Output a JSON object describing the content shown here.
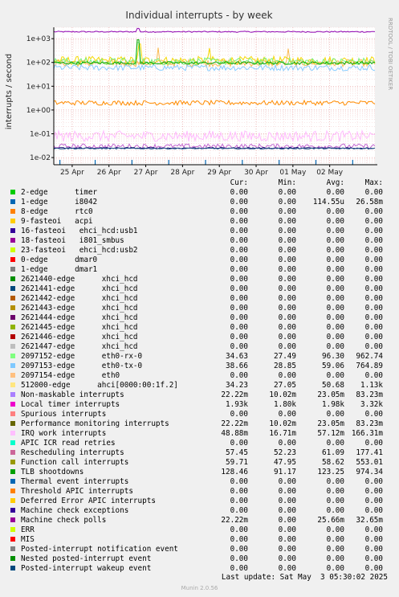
{
  "chart_data": {
    "type": "line",
    "title": "Individual interrupts - by week",
    "ylabel": "interrupts / second",
    "yscale": "log",
    "ylim": [
      0.005,
      3000
    ],
    "yticks": [
      {
        "v": 0.01,
        "label": "1e-02"
      },
      {
        "v": 0.1,
        "label": "1e-01"
      },
      {
        "v": 1,
        "label": "1e+00"
      },
      {
        "v": 10,
        "label": "1e+01"
      },
      {
        "v": 100,
        "label": "1e+02"
      },
      {
        "v": 1000,
        "label": "1e+03"
      }
    ],
    "xlim": [
      "2025-04-24T12:00",
      "2025-05-03T05:30"
    ],
    "xticks": [
      {
        "v": "2025-04-25T00:00",
        "label": "25 Apr"
      },
      {
        "v": "2025-04-26T00:00",
        "label": "26 Apr"
      },
      {
        "v": "2025-04-27T00:00",
        "label": "27 Apr"
      },
      {
        "v": "2025-04-28T00:00",
        "label": "28 Apr"
      },
      {
        "v": "2025-04-29T00:00",
        "label": "29 Apr"
      },
      {
        "v": "2025-04-30T00:00",
        "label": "30 Apr"
      },
      {
        "v": "2025-05-01T00:00",
        "label": "01 May"
      },
      {
        "v": "2025-05-02T00:00",
        "label": "02 May"
      }
    ],
    "grid": true,
    "series_plot": [
      {
        "color": "#8d02b0",
        "base": 1950,
        "noise": 0.05,
        "spikes": [
          [
            "2025-04-26T19:00",
            2700
          ]
        ]
      },
      {
        "color": "#f5d700",
        "base": 120,
        "noise": 0.35,
        "spikes": [
          [
            "2025-04-26T20:00",
            600
          ],
          [
            "2025-04-28T18:00",
            400
          ]
        ]
      },
      {
        "color": "#fab950",
        "base": 95,
        "noise": 0.3,
        "spikes": [
          [
            "2025-04-27T08:00",
            420
          ],
          [
            "2025-04-30T21:00",
            380
          ]
        ]
      },
      {
        "color": "#88ccff",
        "base": 60,
        "noise": 0.25,
        "spikes": []
      },
      {
        "color": "#7bf07b",
        "base": 110,
        "noise": 0.3,
        "spikes": [
          [
            "2025-04-26T19:00",
            700
          ]
        ]
      },
      {
        "color": "#00aa00",
        "base": 95,
        "noise": 0.12,
        "spikes": [
          [
            "2025-04-26T19:00",
            900
          ]
        ]
      },
      {
        "color": "#ff8c00",
        "base": 2,
        "noise": 0.2,
        "spikes": []
      },
      {
        "color": "#ffbbff",
        "base": 0.08,
        "noise": 0.45,
        "spikes": []
      },
      {
        "color": "#c266d1",
        "base": 0.03,
        "noise": 0.2,
        "spikes": []
      },
      {
        "color": "#000066",
        "base": 0.025,
        "noise": 0.05,
        "spikes": []
      },
      {
        "color": "#2a5c8a",
        "base": 0.024,
        "noise": 0.05,
        "spikes": []
      }
    ],
    "pulses": [
      "2025-04-24T16:00",
      "2025-04-25T15:00",
      "2025-04-26T15:00",
      "2025-04-27T15:00",
      "2025-04-28T15:00",
      "2025-04-29T15:00",
      "2025-04-30T15:00",
      "2025-05-01T15:00",
      "2025-05-02T15:00"
    ],
    "pulse_color": "#0066b3"
  },
  "side_label": "RRDTOOL / TOBI OETIKER",
  "legend": {
    "headers": {
      "cur": "Cur:",
      "min": "Min:",
      "avg": "Avg:",
      "max": "Max:"
    },
    "rows": [
      {
        "color": "#00cc00",
        "label": "2-edge      timer",
        "cur": "0.00",
        "min": "0.00",
        "avg": "0.00",
        "max": "0.00"
      },
      {
        "color": "#0066b3",
        "label": "1-edge      i8042",
        "cur": "0.00",
        "min": "0.00",
        "avg": "114.55u",
        "max": "26.58m"
      },
      {
        "color": "#ff8000",
        "label": "8-edge      rtc0",
        "cur": "0.00",
        "min": "0.00",
        "avg": "0.00",
        "max": "0.00"
      },
      {
        "color": "#ffcc00",
        "label": "9-fasteoi   acpi",
        "cur": "0.00",
        "min": "0.00",
        "avg": "0.00",
        "max": "0.00"
      },
      {
        "color": "#330099",
        "label": "16-fasteoi   ehci_hcd:usb1",
        "cur": "0.00",
        "min": "0.00",
        "avg": "0.00",
        "max": "0.00"
      },
      {
        "color": "#990099",
        "label": "18-fasteoi   i801_smbus",
        "cur": "0.00",
        "min": "0.00",
        "avg": "0.00",
        "max": "0.00"
      },
      {
        "color": "#ccff00",
        "label": "23-fasteoi   ehci_hcd:usb2",
        "cur": "0.00",
        "min": "0.00",
        "avg": "0.00",
        "max": "0.00"
      },
      {
        "color": "#ff0000",
        "label": "0-edge      dmar0",
        "cur": "0.00",
        "min": "0.00",
        "avg": "0.00",
        "max": "0.00"
      },
      {
        "color": "#808080",
        "label": "1-edge      dmar1",
        "cur": "0.00",
        "min": "0.00",
        "avg": "0.00",
        "max": "0.00"
      },
      {
        "color": "#008f00",
        "label": "2621440-edge      xhci_hcd",
        "cur": "0.00",
        "min": "0.00",
        "avg": "0.00",
        "max": "0.00"
      },
      {
        "color": "#00487d",
        "label": "2621441-edge      xhci_hcd",
        "cur": "0.00",
        "min": "0.00",
        "avg": "0.00",
        "max": "0.00"
      },
      {
        "color": "#b35a00",
        "label": "2621442-edge      xhci_hcd",
        "cur": "0.00",
        "min": "0.00",
        "avg": "0.00",
        "max": "0.00"
      },
      {
        "color": "#b38f00",
        "label": "2621443-edge      xhci_hcd",
        "cur": "0.00",
        "min": "0.00",
        "avg": "0.00",
        "max": "0.00"
      },
      {
        "color": "#6b006b",
        "label": "2621444-edge      xhci_hcd",
        "cur": "0.00",
        "min": "0.00",
        "avg": "0.00",
        "max": "0.00"
      },
      {
        "color": "#8fb300",
        "label": "2621445-edge      xhci_hcd",
        "cur": "0.00",
        "min": "0.00",
        "avg": "0.00",
        "max": "0.00"
      },
      {
        "color": "#b30000",
        "label": "2621446-edge      xhci_hcd",
        "cur": "0.00",
        "min": "0.00",
        "avg": "0.00",
        "max": "0.00"
      },
      {
        "color": "#bebebe",
        "label": "2621447-edge      xhci_hcd",
        "cur": "0.00",
        "min": "0.00",
        "avg": "0.00",
        "max": "0.00"
      },
      {
        "color": "#80ff80",
        "label": "2097152-edge      eth0-rx-0",
        "cur": "34.63",
        "min": "27.49",
        "avg": "96.30",
        "max": "962.74"
      },
      {
        "color": "#80c9ff",
        "label": "2097153-edge      eth0-tx-0",
        "cur": "38.66",
        "min": "28.85",
        "avg": "59.06",
        "max": "764.89"
      },
      {
        "color": "#ffc080",
        "label": "2097154-edge      eth0",
        "cur": "0.00",
        "min": "0.00",
        "avg": "0.00",
        "max": "0.00"
      },
      {
        "color": "#ffe680",
        "label": "512000-edge      ahci[0000:00:1f.2]",
        "cur": "34.23",
        "min": "27.05",
        "avg": "50.68",
        "max": "1.13k"
      },
      {
        "color": "#aa80ff",
        "label": "Non-maskable interrupts",
        "cur": "22.22m",
        "min": "10.02m",
        "avg": "23.05m",
        "max": "83.23m"
      },
      {
        "color": "#ee00cc",
        "label": "Local timer interrupts",
        "cur": "1.93k",
        "min": "1.80k",
        "avg": "1.98k",
        "max": "3.32k"
      },
      {
        "color": "#ff8080",
        "label": "Spurious interrupts",
        "cur": "0.00",
        "min": "0.00",
        "avg": "0.00",
        "max": "0.00"
      },
      {
        "color": "#666600",
        "label": "Performance monitoring interrupts",
        "cur": "22.22m",
        "min": "10.02m",
        "avg": "23.05m",
        "max": "83.23m"
      },
      {
        "color": "#ffbfff",
        "label": "IRQ work interrupts",
        "cur": "48.88m",
        "min": "16.71m",
        "avg": "57.12m",
        "max": "166.31m"
      },
      {
        "color": "#00ffcc",
        "label": "APIC ICR read retries",
        "cur": "0.00",
        "min": "0.00",
        "avg": "0.00",
        "max": "0.00"
      },
      {
        "color": "#cc6699",
        "label": "Rescheduling interrupts",
        "cur": "57.45",
        "min": "52.23",
        "avg": "61.09",
        "max": "177.41"
      },
      {
        "color": "#999900",
        "label": "Function call interrupts",
        "cur": "59.71",
        "min": "47.95",
        "avg": "58.62",
        "max": "553.01"
      },
      {
        "color": "#00a000",
        "label": "TLB shootdowns",
        "cur": "128.46",
        "min": "91.17",
        "avg": "123.25",
        "max": "974.34"
      },
      {
        "color": "#0066b3",
        "label": "Thermal event interrupts",
        "cur": "0.00",
        "min": "0.00",
        "avg": "0.00",
        "max": "0.00"
      },
      {
        "color": "#ff8000",
        "label": "Threshold APIC interrupts",
        "cur": "0.00",
        "min": "0.00",
        "avg": "0.00",
        "max": "0.00"
      },
      {
        "color": "#ffcc00",
        "label": "Deferred Error APIC interrupts",
        "cur": "0.00",
        "min": "0.00",
        "avg": "0.00",
        "max": "0.00"
      },
      {
        "color": "#330099",
        "label": "Machine check exceptions",
        "cur": "0.00",
        "min": "0.00",
        "avg": "0.00",
        "max": "0.00"
      },
      {
        "color": "#990099",
        "label": "Machine check polls",
        "cur": "22.22m",
        "min": "0.00",
        "avg": "25.66m",
        "max": "32.65m"
      },
      {
        "color": "#ccff00",
        "label": "ERR",
        "cur": "0.00",
        "min": "0.00",
        "avg": "0.00",
        "max": "0.00"
      },
      {
        "color": "#ff0000",
        "label": "MIS",
        "cur": "0.00",
        "min": "0.00",
        "avg": "0.00",
        "max": "0.00"
      },
      {
        "color": "#808080",
        "label": "Posted-interrupt notification event",
        "cur": "0.00",
        "min": "0.00",
        "avg": "0.00",
        "max": "0.00"
      },
      {
        "color": "#008f00",
        "label": "Nested posted-interrupt event",
        "cur": "0.00",
        "min": "0.00",
        "avg": "0.00",
        "max": "0.00"
      },
      {
        "color": "#00487d",
        "label": "Posted-interrupt wakeup event",
        "cur": "0.00",
        "min": "0.00",
        "avg": "0.00",
        "max": "0.00"
      }
    ]
  },
  "last_update": "Last update: Sat May  3 05:30:02 2025",
  "version": "Munin 2.0.56"
}
